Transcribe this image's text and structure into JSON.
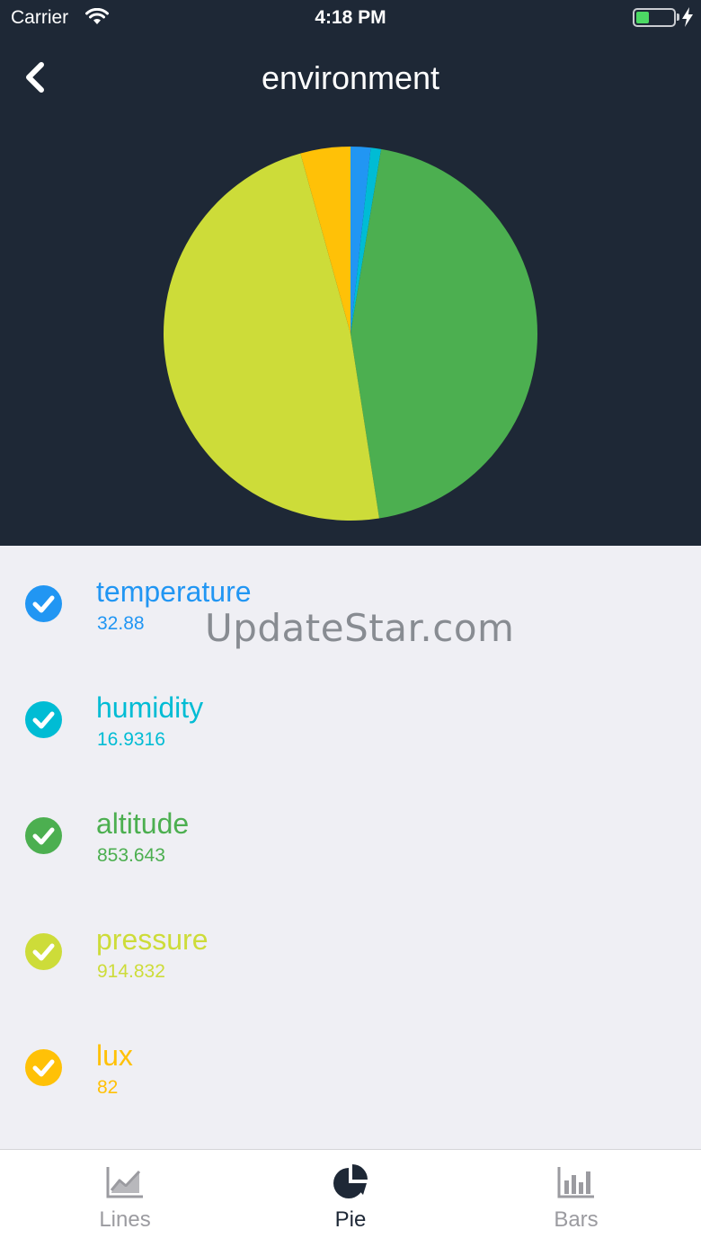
{
  "status_bar": {
    "carrier": "Carrier",
    "time": "4:18 PM"
  },
  "nav": {
    "title": "environment"
  },
  "chart_data": {
    "type": "pie",
    "categories": [
      "temperature",
      "humidity",
      "altitude",
      "pressure",
      "lux"
    ],
    "values": [
      32.88,
      16.9316,
      853.643,
      914.832,
      82
    ],
    "colors": [
      "#2196f3",
      "#00bcd4",
      "#4caf50",
      "#cddc39",
      "#ffc107"
    ]
  },
  "legend": {
    "items": [
      {
        "name": "temperature",
        "value": "32.88",
        "color": "#2196f3"
      },
      {
        "name": "humidity",
        "value": "16.9316",
        "color": "#00bcd4"
      },
      {
        "name": "altitude",
        "value": "853.643",
        "color": "#4caf50"
      },
      {
        "name": "pressure",
        "value": "914.832",
        "color": "#cddc39"
      },
      {
        "name": "lux",
        "value": "82",
        "color": "#ffc107"
      }
    ]
  },
  "watermark": "UpdateStar.com",
  "tabs": [
    {
      "label": "Lines",
      "icon": "line-chart-icon",
      "active": false
    },
    {
      "label": "Pie",
      "icon": "pie-chart-icon",
      "active": true
    },
    {
      "label": "Bars",
      "icon": "bar-chart-icon",
      "active": false
    }
  ],
  "colors": {
    "header_bg": "#1e2836",
    "list_bg": "#efeff4",
    "tab_active": "#1e2836",
    "tab_inactive": "#9b9ba0"
  }
}
